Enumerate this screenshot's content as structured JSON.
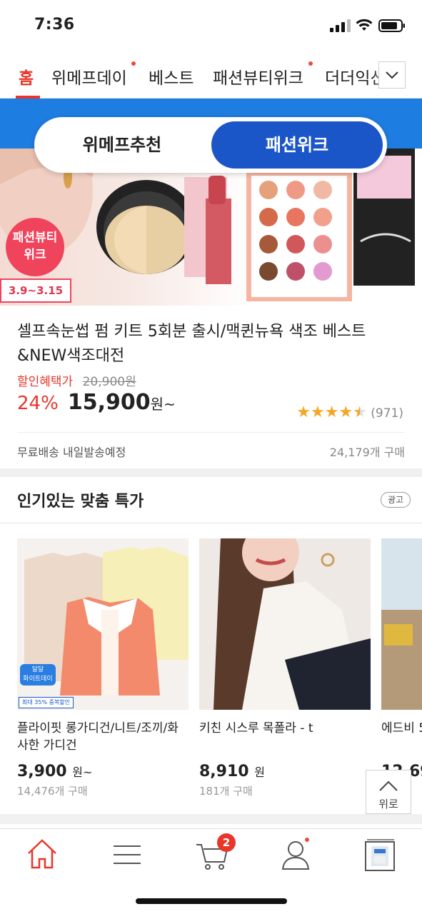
{
  "status_bar": {
    "time": "7:36"
  },
  "top_nav": {
    "tabs": [
      {
        "label": "홈",
        "active": true
      },
      {
        "label": "위메프데이",
        "new_dot": true
      },
      {
        "label": "베스트"
      },
      {
        "label": "패션뷰티위크",
        "new_dot": true
      },
      {
        "label": "더더익선"
      }
    ],
    "more_icon": "chevron-down-icon"
  },
  "banner": {
    "toggle": {
      "left": "위메프추천",
      "right": "패션위크",
      "selected": "right"
    },
    "badge": "패션뷰티\n위크",
    "date_tag": "3.9~3.15"
  },
  "featured_product": {
    "title": "셀프속눈썹 펌 키트 5회분 출시/맥퀸뉴욕 색조 베스트 &NEW색조대전",
    "discount_label": "할인혜택가",
    "original_price": "20,900원",
    "discount_percent": "24%",
    "price": "15,900",
    "price_unit": "원~",
    "rating_value": 4.5,
    "rating_count": "(971)",
    "shipping": "무료배송  내일발송예정",
    "sold": "24,179개 구매"
  },
  "section": {
    "title": "인기있는 맞춤 특가",
    "ad_label": "광고",
    "products": [
      {
        "name": "플라이핏 롱가디건/니트/조끼/화사한 가디건",
        "price": "3,900",
        "unit": "원~",
        "sold": "14,476개 구매",
        "img_badge": "달달\n화이트데이",
        "img_tag": "최대 35% 중복할인"
      },
      {
        "name": "키친 시스루 목폴라 - t",
        "price": "8,910",
        "unit": "원",
        "sold": "181개 구매"
      },
      {
        "name": "에드비 5",
        "price": "12,69",
        "unit": "",
        "sold": ""
      }
    ]
  },
  "scroll_top": {
    "label": "위로"
  },
  "bottom_nav": {
    "items": [
      {
        "icon": "home-icon"
      },
      {
        "icon": "menu-icon"
      },
      {
        "icon": "cart-icon",
        "badge": "2"
      },
      {
        "icon": "user-icon",
        "new_dot": true
      },
      {
        "icon": "recent-item-icon"
      }
    ]
  },
  "colors": {
    "accent_red": "#e8362a",
    "brand_blue": "#1a56c8",
    "banner_blue": "#1e7de0",
    "star": "#f5a623"
  }
}
